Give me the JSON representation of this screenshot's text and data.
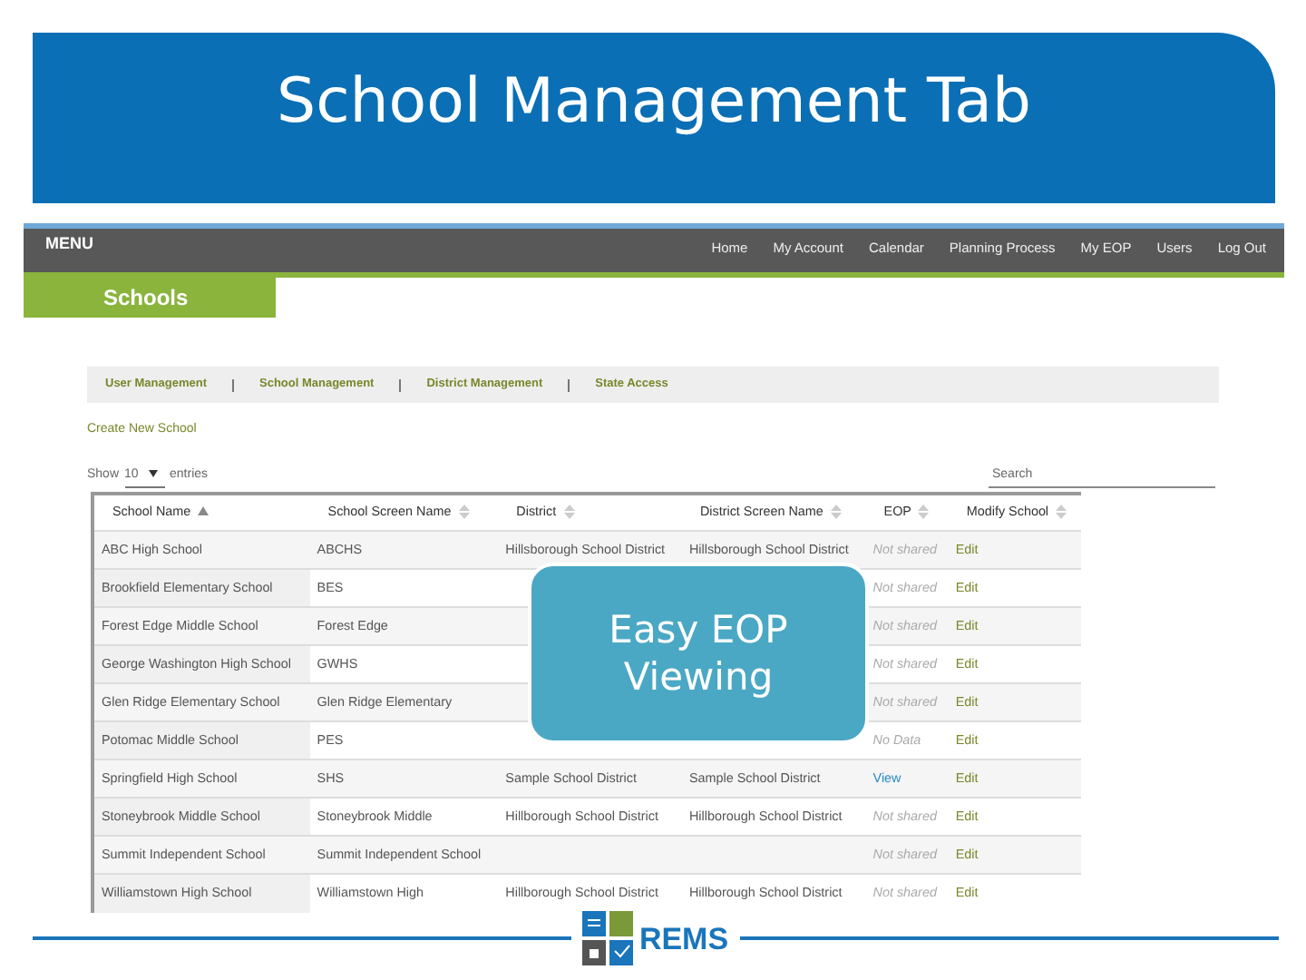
{
  "slide": {
    "title": "School Management Tab",
    "callout": "Easy EOP Viewing"
  },
  "app": {
    "menu_label": "MENU",
    "nav": [
      {
        "label": "Home"
      },
      {
        "label": "My Account"
      },
      {
        "label": "Calendar"
      },
      {
        "label": "Planning Process"
      },
      {
        "label": "My EOP"
      },
      {
        "label": "Users"
      },
      {
        "label": "Log Out"
      }
    ],
    "section_tab": "Schools",
    "subnav": [
      "User Management",
      "School Management",
      "District Management",
      "State Access"
    ],
    "create_link": "Create New School",
    "show": {
      "before": "Show",
      "value": "10",
      "after": "entries"
    },
    "search_label": "Search",
    "table": {
      "columns": [
        {
          "label": "School Name",
          "sorted": true
        },
        {
          "label": "School Screen Name",
          "sorted": false
        },
        {
          "label": "District",
          "sorted": false
        },
        {
          "label": "District Screen Name",
          "sorted": false
        },
        {
          "label": "EOP",
          "sorted": false
        },
        {
          "label": "Modify School",
          "sorted": false
        }
      ],
      "rows": [
        {
          "school": "ABC High School",
          "screen": "ABCHS",
          "district": "Hillsborough School District",
          "district_screen": "Hillsborough School District",
          "eop": {
            "text": "Not shared",
            "kind": "status"
          },
          "action": "Edit"
        },
        {
          "school": "Brookfield Elementary School",
          "screen": "BES",
          "eop": {
            "text": "Not shared",
            "kind": "status"
          },
          "action": "Edit"
        },
        {
          "school": "Forest Edge Middle School",
          "screen": "Forest Edge",
          "eop": {
            "text": "Not shared",
            "kind": "status"
          },
          "action": "Edit"
        },
        {
          "school": "George Washington High School",
          "screen": "GWHS",
          "eop": {
            "text": "Not shared",
            "kind": "status"
          },
          "action": "Edit"
        },
        {
          "school": "Glen Ridge Elementary School",
          "screen": "Glen Ridge Elementary",
          "eop": {
            "text": "Not shared",
            "kind": "status"
          },
          "action": "Edit"
        },
        {
          "school": "Potomac Middle School",
          "screen": "PES",
          "eop": {
            "text": "No Data",
            "kind": "status"
          },
          "action": "Edit"
        },
        {
          "school": "Springfield High School",
          "screen": "SHS",
          "district": "Sample School District",
          "district_screen": "Sample School District",
          "eop": {
            "text": "View",
            "kind": "link"
          },
          "action": "Edit"
        },
        {
          "school": "Stoneybrook Middle School",
          "screen": "Stoneybrook Middle",
          "district": "Hillborough School District",
          "district_screen": "Hillborough School District",
          "eop": {
            "text": "Not shared",
            "kind": "status"
          },
          "action": "Edit"
        },
        {
          "school": "Summit Independent School",
          "screen": "Summit Independent School",
          "eop": {
            "text": "Not shared",
            "kind": "status"
          },
          "action": "Edit"
        },
        {
          "school": "Williamstown High School",
          "screen": "Williamstown High",
          "district": "Hillborough School District",
          "district_screen": "Hillborough School District",
          "eop": {
            "text": "Not shared",
            "kind": "status"
          },
          "action": "Edit"
        }
      ]
    }
  },
  "footer": {
    "logo": "REMS"
  }
}
